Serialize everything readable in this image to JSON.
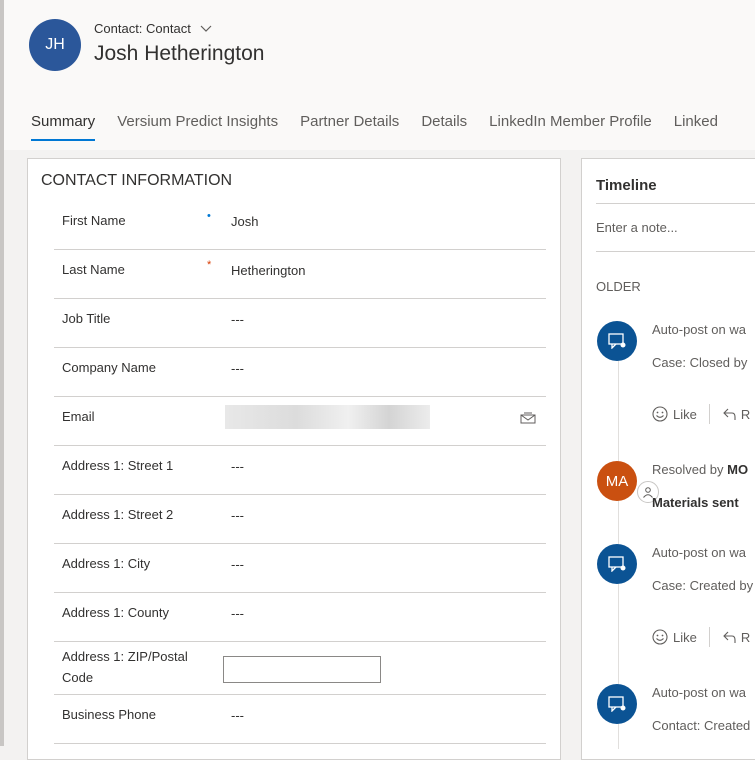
{
  "header": {
    "avatar_initials": "JH",
    "entity_label": "Contact: Contact",
    "record_name": "Josh Hetherington"
  },
  "tabs": [
    {
      "label": "Summary"
    },
    {
      "label": "Versium Predict Insights"
    },
    {
      "label": "Partner Details"
    },
    {
      "label": "Details"
    },
    {
      "label": "LinkedIn Member Profile"
    },
    {
      "label": "Linked"
    }
  ],
  "contact_section": {
    "title": "CONTACT INFORMATION",
    "fields": [
      {
        "label": "First Name",
        "value": "Josh"
      },
      {
        "label": "Last Name",
        "value": "Hetherington"
      },
      {
        "label": "Job Title",
        "value": "---"
      },
      {
        "label": "Company Name",
        "value": "---"
      },
      {
        "label": "Email",
        "value": ""
      },
      {
        "label": "Address 1: Street 1",
        "value": "---"
      },
      {
        "label": "Address 1: Street 2",
        "value": "---"
      },
      {
        "label": "Address 1: City",
        "value": "---"
      },
      {
        "label": "Address 1: County",
        "value": "---"
      },
      {
        "label": "Address 1: ZIP/Postal Code",
        "value": ""
      },
      {
        "label": "Business Phone",
        "value": "---"
      }
    ]
  },
  "timeline": {
    "title": "Timeline",
    "note_placeholder": "Enter a note...",
    "group_label": "OLDER",
    "items": [
      {
        "line1": "Auto-post on wa",
        "line2": "Case: Closed by",
        "like": "Like",
        "reply": "R"
      },
      {
        "avatar": "MA",
        "line1_prefix": "Resolved by ",
        "line1_name": "MO",
        "line2": "Materials sent"
      },
      {
        "line1": "Auto-post on wa",
        "line2": "Case: Created by",
        "like": "Like",
        "reply": "R"
      },
      {
        "line1": "Auto-post on wa",
        "line2": "Contact: Created"
      }
    ]
  },
  "colors": {
    "accent": "#0078d4",
    "avatar_blue": "#2b579a",
    "avatar_orange": "#ca5010"
  }
}
